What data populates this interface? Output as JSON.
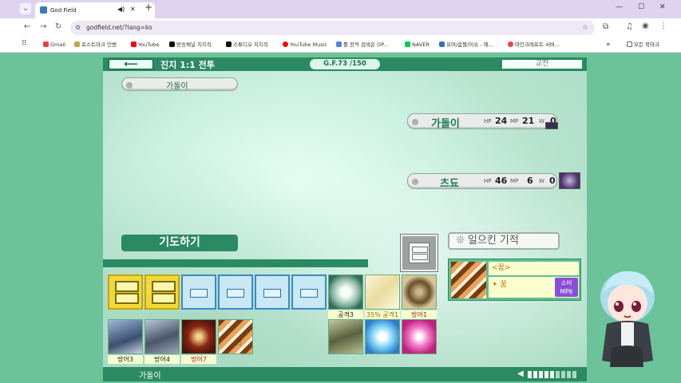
{
  "browser": {
    "tab_title": "God Field",
    "url": "godfield.net/?lang=ko",
    "bookmarks": [
      "Gmail",
      "로스트마크 인벤",
      "YouTube",
      "방송채널 치지직",
      "스튜디오 치지직",
      "YouTube Music",
      "롤 전적 검색은 OP...",
      "NAVER",
      "유머/움짤/이슈 - 에...",
      "마인크래프트 서버..."
    ],
    "all_bookmarks": "모든 북마크"
  },
  "game": {
    "title": "진지 1:1 전투",
    "gf": "G.F.73 /150",
    "trade": "교전",
    "me_name": "가돌이",
    "opponents": [
      {
        "name": "가돌이",
        "hp": "24",
        "mp": "21",
        "w": "0"
      },
      {
        "name": "츠됴",
        "hp": "46",
        "mp": "6",
        "w": "0"
      }
    ],
    "stat_labels": {
      "hp": "HP",
      "mp": "MP",
      "w": "W"
    },
    "pray": "기도하기",
    "miracle": "일으킨 기적",
    "selected": {
      "title": "<꿈>",
      "name": "꿈",
      "cost": "소비",
      "cost_value": "MP6"
    },
    "card_labels": [
      "공격3",
      "35% 공격1",
      "방어1",
      "방어3",
      "방어4",
      "방어7"
    ],
    "bottom_name": "가돌이"
  }
}
